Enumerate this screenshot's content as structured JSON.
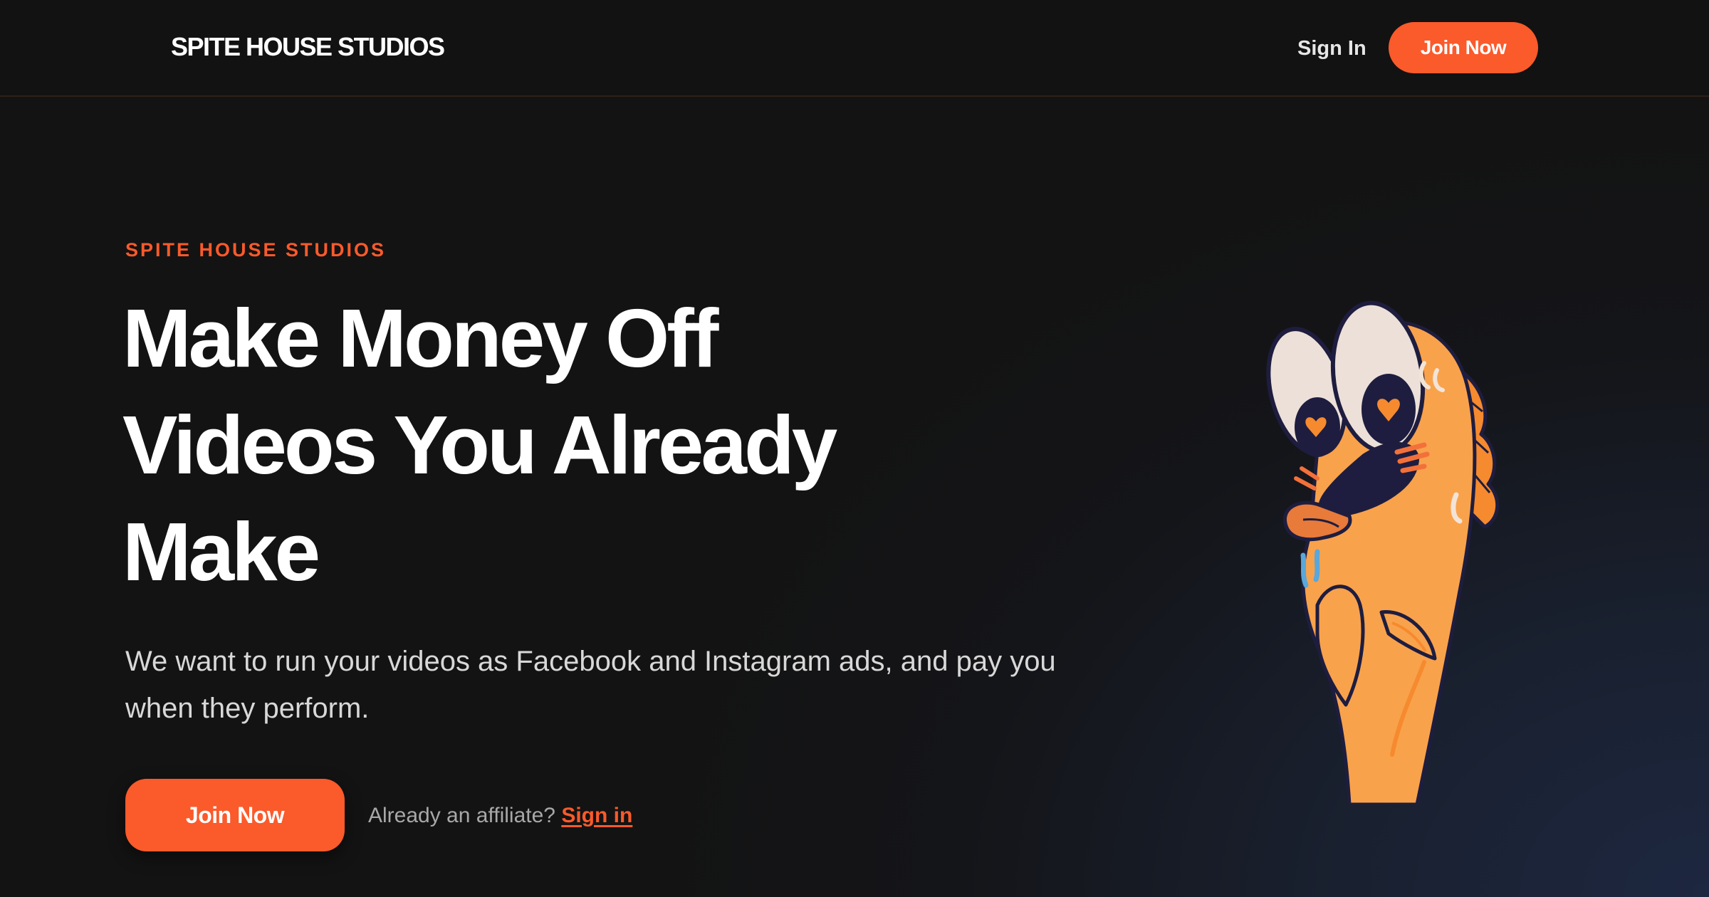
{
  "nav": {
    "brand": "SPITE HOUSE STUDIOS",
    "sign_in": "Sign In",
    "join_now": "Join Now"
  },
  "hero": {
    "eyebrow": "SPITE HOUSE STUDIOS",
    "headline_lines": [
      "Make Money Off",
      "Videos You Already",
      "Make"
    ],
    "subtext": "We want to run your videos as Facebook and Instagram ads, and pay you when they perform.",
    "cta_join": "Join Now",
    "affiliate_prompt": "Already an affiliate?",
    "affiliate_link": "Sign in",
    "mascot_icon": "orange-fish-mascot-illustration"
  },
  "colors": {
    "accent": "#fb5a2b",
    "background": "#131313",
    "navbar": "#121212",
    "mascot_body": "#f9a24c",
    "mascot_outline": "#1e1d3f"
  }
}
